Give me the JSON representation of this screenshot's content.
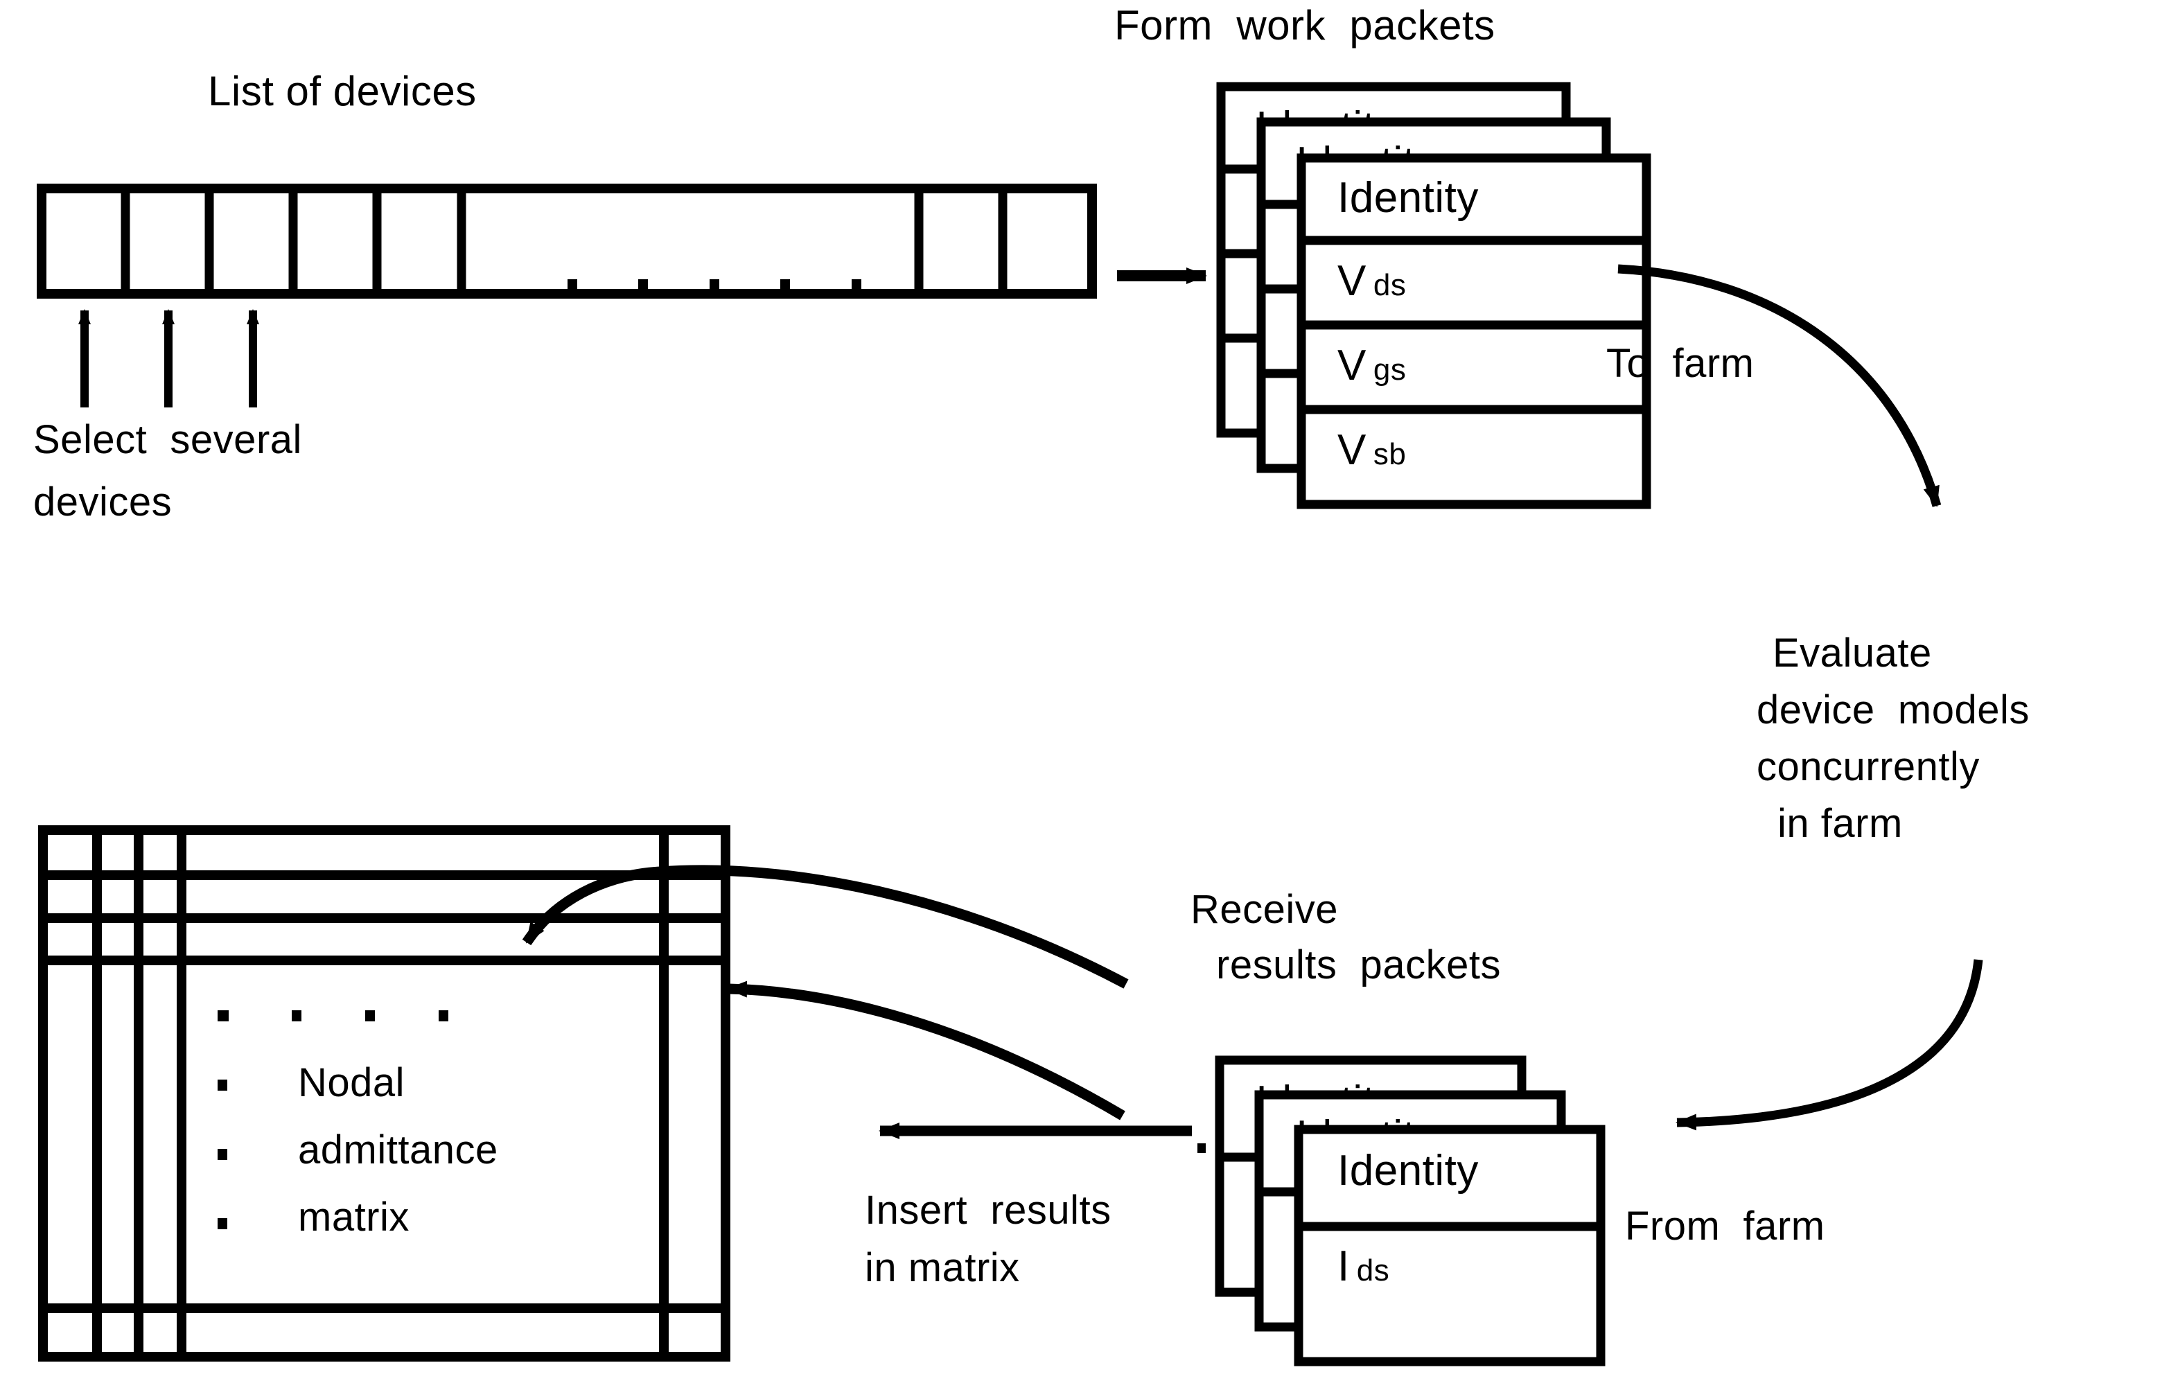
{
  "diagram": {
    "title_list_of_devices": "List of devices",
    "title_form_work_packets": "Form  work  packets",
    "title_receive_results_packets_line1": "Receive",
    "title_receive_results_packets_line2": "results  packets",
    "label_select_several_line1": "Select  several",
    "label_select_several_line2": "devices",
    "label_to_farm": "To  farm",
    "label_from_farm": "From  farm",
    "label_insert_results_line1": "Insert  results",
    "label_insert_results_line2": "in matrix",
    "label_evaluate_line1": "Evaluate",
    "label_evaluate_line2": "device  models",
    "label_evaluate_line3": "concurrently",
    "label_evaluate_line4": "in farm",
    "matrix_label_line1": "Nodal",
    "matrix_label_line2": "admittance",
    "matrix_label_line3": "matrix"
  },
  "device_list": {
    "cell_count_left": 5,
    "cell_count_right": 2,
    "ellipsis_dot_count": 5
  },
  "work_packet": {
    "stack_count": 3,
    "rows": [
      {
        "base": "Identity",
        "sub": ""
      },
      {
        "base": "V",
        "sub": "ds"
      },
      {
        "base": "V",
        "sub": "gs"
      },
      {
        "base": "V",
        "sub": "sb"
      }
    ]
  },
  "results_packet": {
    "stack_count": 3,
    "rows": [
      {
        "base": "Identity",
        "sub": ""
      },
      {
        "base": "I",
        "sub": "ds"
      }
    ]
  },
  "matrix": {
    "row_dots": 4,
    "col_dots": 3
  },
  "colors": {
    "ink": "#000000",
    "paper": "#ffffff"
  }
}
